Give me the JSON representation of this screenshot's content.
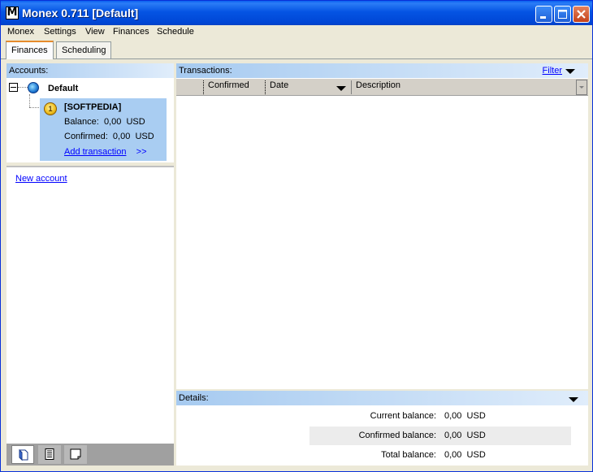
{
  "window": {
    "title": "Monex 0.711 [Default]",
    "app_icon_letter": "M"
  },
  "menu": [
    "Monex",
    "Settings",
    "View",
    "Finances",
    "Schedule"
  ],
  "tabs": [
    {
      "label": "Finances",
      "active": true
    },
    {
      "label": "Scheduling",
      "active": false
    }
  ],
  "accounts": {
    "header": "Accounts:",
    "group": "Default",
    "account": {
      "badge": "1",
      "name": "[SOFTPEDIA]",
      "balance_label": "Balance:",
      "balance_value": "0,00",
      "confirmed_label": "Confirmed:",
      "confirmed_value": "0,00",
      "currency": "USD",
      "add_transaction": "Add transaction",
      "add_arrows": ">>"
    },
    "new_account": "New account"
  },
  "transactions": {
    "header": "Transactions:",
    "filter": "Filter",
    "columns": [
      "Confirmed",
      "Date",
      "Description"
    ]
  },
  "details": {
    "header": "Details:",
    "rows": [
      {
        "label": "Current balance:",
        "value": "0,00",
        "currency": "USD"
      },
      {
        "label": "Confirmed balance:",
        "value": "0,00",
        "currency": "USD"
      },
      {
        "label": "Total balance:",
        "value": "0,00",
        "currency": "USD"
      }
    ]
  },
  "bottom_toolbar": [
    "book-icon",
    "list-icon",
    "note-icon"
  ]
}
